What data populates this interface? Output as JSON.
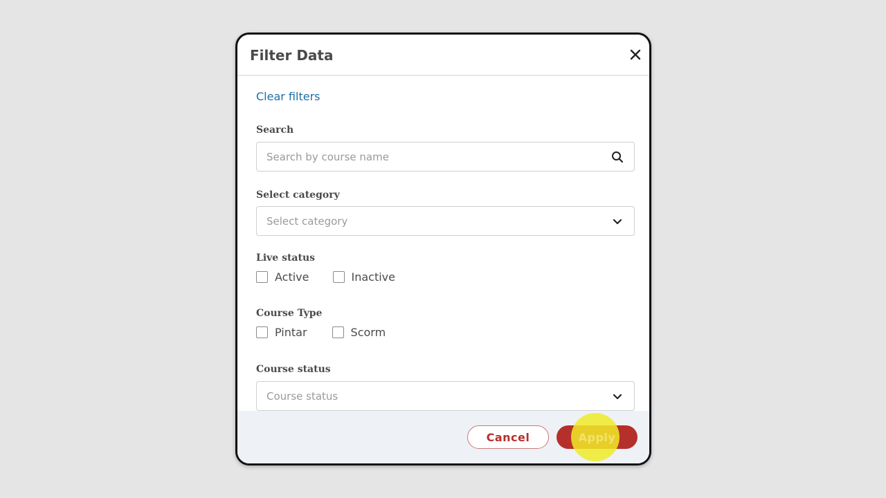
{
  "dialog": {
    "title": "Filter Data",
    "clear_link": "Clear filters"
  },
  "search": {
    "label": "Search",
    "placeholder": "Search by course name",
    "icon": "search-icon"
  },
  "category": {
    "label": "Select category",
    "placeholder": "Select category",
    "icon": "chevron-down-icon"
  },
  "live_status": {
    "label": "Live status",
    "options": [
      "Active",
      "Inactive"
    ]
  },
  "course_type": {
    "label": "Course Type",
    "options": [
      "Pintar",
      "Scorm"
    ]
  },
  "course_status": {
    "label": "Course status",
    "placeholder": "Course status",
    "icon": "chevron-down-icon"
  },
  "footer": {
    "cancel_label": "Cancel",
    "apply_label": "Apply"
  },
  "colors": {
    "accent": "#b5302b",
    "link": "#1b6fa8",
    "highlight": "#f0eb28"
  }
}
